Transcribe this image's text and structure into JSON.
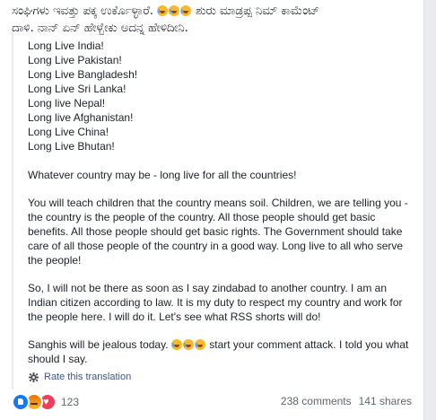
{
  "post": {
    "original_text_part1": "ಸಂಘಿಗಳು ಇವತ್ತು ಪಕ್ಕ ಉರ್ಕೊಳ್ಳಾರೆ.",
    "original_text_part2": "ಶುರು ಮಾಡ್ರಪ್ಪ ನಿಮ್ ಕಾಮೆಂಟ್",
    "original_text_line2": "ದಾಳಿ. ನಾನ್ ಏನ್ ಹೇಳ್ಬೇಕು ಅದನ್ನ ಹೇಳಿದೀನಿ."
  },
  "translation": {
    "countries": [
      "Long Live India!",
      "Long Live Pakistan!",
      "Long Live Bangladesh!",
      "Long Live Sri Lanka!",
      "Long live Nepal!",
      "Long live Afghanistan!",
      "Long Live China!",
      "Long Live Bhutan!"
    ],
    "para1": "Whatever country may be - long live for all the countries!",
    "para2": "You will teach children that the country means soil. Children, we are telling you - the country is the people of the country. All those people should get basic benefits. All those people should get basic rights. The Government should take care of all those people of the country in a good way. Long live to all who serve the people!",
    "para3": "So, I will not be there as soon as I say zindabad to another country. I am an Indian citizen according to law. It is my duty to respect my country and work for the people here. I will do it. Let's see what RSS shorts will do!",
    "para4_part1": "Sanghis will be jealous today.",
    "para4_part2": "start your comment attack. I told you what should I say.",
    "rate_label": "Rate this translation"
  },
  "footer": {
    "reaction_count": "123",
    "comments": "238 comments",
    "shares": "141 shares"
  },
  "icons": {
    "emoji": "laughing-tears-emoji-icon",
    "gear": "gear-icon",
    "like": "like-reaction-icon",
    "angry": "angry-reaction-icon",
    "love": "love-reaction-icon"
  },
  "colors": {
    "link": "#385898",
    "like_blue": "#1877f2",
    "love_red": "#f33e58",
    "emoji_yellow": "#f7b928",
    "muted": "#606770"
  }
}
